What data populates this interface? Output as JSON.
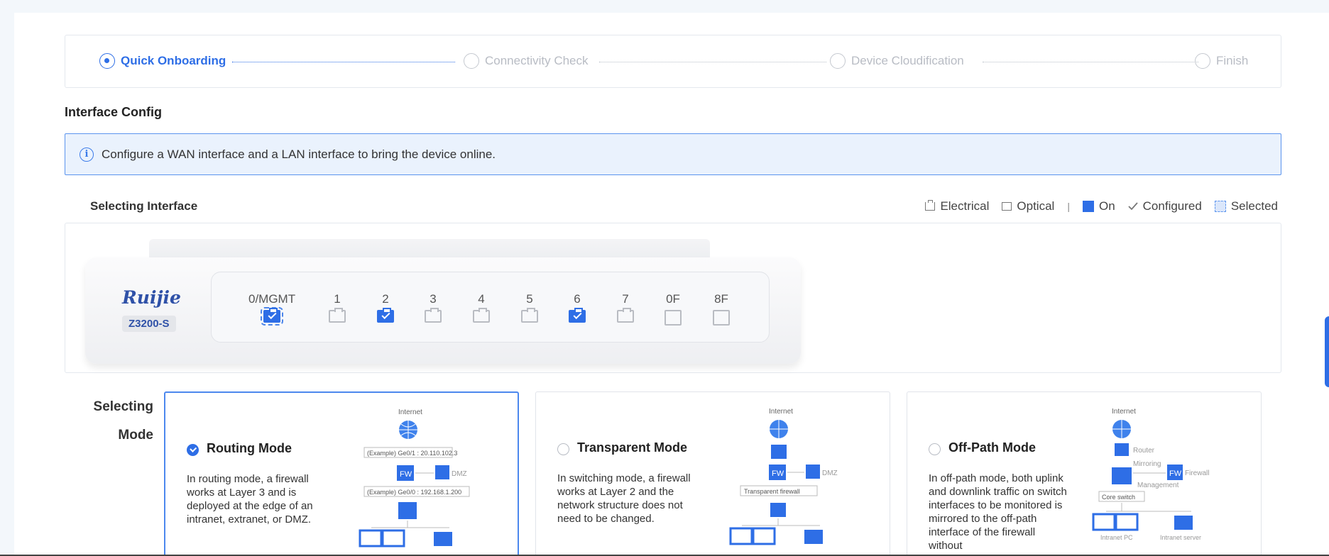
{
  "steps": [
    {
      "label": "Quick Onboarding",
      "active": true
    },
    {
      "label": "Connectivity Check",
      "active": false
    },
    {
      "label": "Device Cloudification",
      "active": false
    },
    {
      "label": "Finish",
      "active": false
    }
  ],
  "section_title": "Interface Config",
  "alert": {
    "icon": "info-icon",
    "text": "Configure a WAN interface and a LAN interface to bring the device online."
  },
  "interface": {
    "title": "Selecting Interface",
    "legend": {
      "electrical": "Electrical",
      "optical": "Optical",
      "separator": "|",
      "on": "On",
      "configured": "Configured",
      "selected": "Selected"
    }
  },
  "device": {
    "brand": "Ruijie",
    "model": "Z3200-S",
    "ports": [
      {
        "label": "0/MGMT",
        "kind": "electrical",
        "on": true,
        "selected": true
      },
      {
        "label": "1",
        "kind": "electrical",
        "on": false,
        "selected": false
      },
      {
        "label": "2",
        "kind": "electrical",
        "on": true,
        "selected": false
      },
      {
        "label": "3",
        "kind": "electrical",
        "on": false,
        "selected": false
      },
      {
        "label": "4",
        "kind": "electrical",
        "on": false,
        "selected": false
      },
      {
        "label": "5",
        "kind": "electrical",
        "on": false,
        "selected": false
      },
      {
        "label": "6",
        "kind": "electrical",
        "on": true,
        "selected": false
      },
      {
        "label": "7",
        "kind": "electrical",
        "on": false,
        "selected": false
      },
      {
        "label": "0F",
        "kind": "optical",
        "on": false,
        "selected": false
      },
      {
        "label": "8F",
        "kind": "optical",
        "on": false,
        "selected": false
      }
    ]
  },
  "mode": {
    "label_line1": "Selecting",
    "label_line2": "Mode",
    "cards": [
      {
        "title": "Routing Mode",
        "selected": true,
        "desc": "In routing mode, a firewall works at Layer 3 and is deployed at the edge of an intranet, extranet, or DMZ.",
        "diagram": {
          "internet": "Internet",
          "ge1": "(Example) Ge0/1 : 20.110.102.3",
          "fw": "FW",
          "dmz": "DMZ",
          "ge0": "(Example) Ge0/0 : 192.168.1.200"
        }
      },
      {
        "title": "Transparent Mode",
        "selected": false,
        "desc": "In switching mode, a firewall works at Layer 2 and the network structure does not need to be changed.",
        "diagram": {
          "internet": "Internet",
          "fw": "FW",
          "dmz": "DMZ",
          "tfw": "Transparent firewall"
        }
      },
      {
        "title": "Off-Path Mode",
        "selected": false,
        "desc": "In off-path mode, both uplink and downlink traffic on switch interfaces to be monitored is mirrored to the off-path interface of the firewall without",
        "diagram": {
          "internet": "Internet",
          "router": "Router",
          "mirroring": "Mirroring",
          "fw": "FW",
          "firewall": "Firewall",
          "management": "Management",
          "core": "Core switch",
          "pc": "Intranet PC",
          "server": "Intranet server"
        }
      }
    ]
  },
  "colors": {
    "accent": "#2e6ee6",
    "alert_bg": "#eaf2fd",
    "brand": "#2f51a8"
  }
}
